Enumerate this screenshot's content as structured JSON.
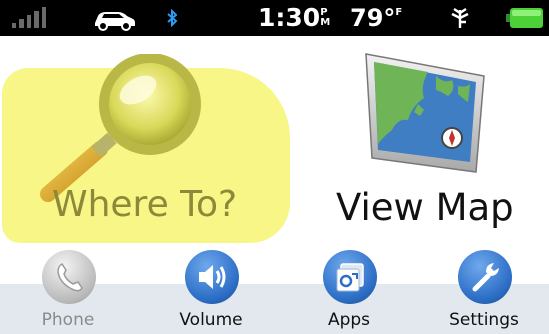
{
  "status": {
    "time": "1:30",
    "time_suffix": "PM",
    "temperature": "79°",
    "temperature_unit": "F",
    "icons": [
      "signal-bars-icon",
      "car-icon",
      "bluetooth-icon",
      "antenna-icon",
      "battery-icon"
    ],
    "battery_color": "#4cd137"
  },
  "tiles": {
    "where_to": {
      "label": "Where To?",
      "icon": "magnifying-glass-icon",
      "highlight_color": "#f6f57a"
    },
    "view_map": {
      "label": "View Map",
      "icon": "map-icon"
    }
  },
  "dock": [
    {
      "label": "Phone",
      "icon": "phone-icon",
      "enabled": false
    },
    {
      "label": "Volume",
      "icon": "speaker-icon",
      "enabled": true
    },
    {
      "label": "Apps",
      "icon": "apps-icon",
      "enabled": true
    },
    {
      "label": "Settings",
      "icon": "wrench-icon",
      "enabled": true
    }
  ],
  "colors": {
    "accent_blue": "#2d6fc7",
    "status_bar": "#000000",
    "dock_bg": "#e3e8ef"
  }
}
